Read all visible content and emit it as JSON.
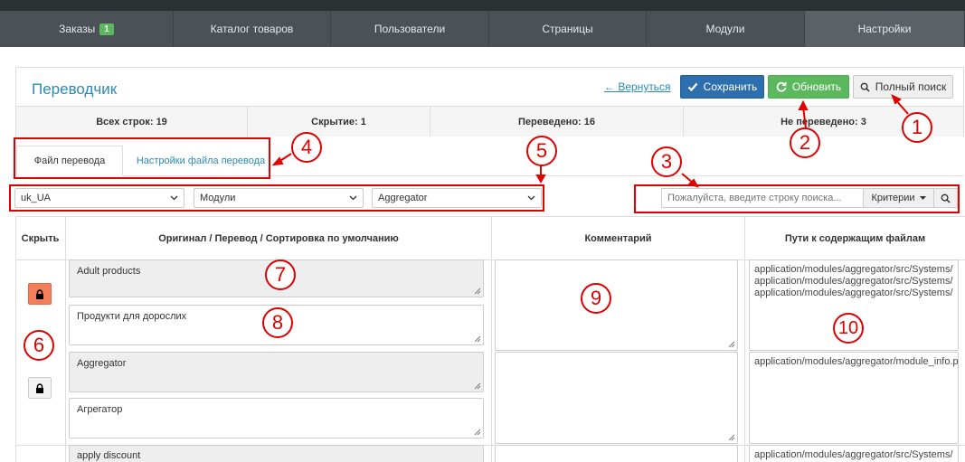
{
  "nav": {
    "items": [
      {
        "label": "Заказы",
        "badge": "1"
      },
      {
        "label": "Каталог товаров"
      },
      {
        "label": "Пользователи"
      },
      {
        "label": "Страницы"
      },
      {
        "label": "Модули"
      },
      {
        "label": "Настройки"
      }
    ]
  },
  "header": {
    "title": "Переводчик",
    "back_label": "← Вернуться",
    "save_label": "Сохранить",
    "refresh_label": "Обновить",
    "fullsearch_label": "Полный поиск"
  },
  "stats": [
    "Всех строк: 19",
    "Скрытие: 1",
    "Переведено: 16",
    "Не переведено: 3"
  ],
  "tabs": [
    "Файл перевода",
    "Настройки файла перевода"
  ],
  "filters": {
    "lang": "uk_UA",
    "type": "Модули",
    "module": "Aggregator",
    "search_placeholder": "Пожалуйста, введите строку поиска...",
    "criteria_label": "Критерии"
  },
  "table": {
    "headers": {
      "hide": "Скрыть",
      "original": "Оригинал / Перевод / Сортировка по умолчанию",
      "comment": "Комментарий",
      "paths": "Пути к содержащим файлам"
    },
    "rows": [
      {
        "original": "Adult products",
        "translation": "Продукти для дорослих",
        "paths": [
          "application/modules/aggregator/src/Systems/",
          "application/modules/aggregator/src/Systems/",
          "application/modules/aggregator/src/Systems/"
        ]
      },
      {
        "original": "Aggregator",
        "translation": "Агрегатор",
        "paths": [
          "application/modules/aggregator/module_info.p"
        ]
      },
      {
        "original": "apply discount",
        "translation": "",
        "paths": [
          "application/modules/aggregator/src/Systems/"
        ]
      }
    ]
  },
  "annotations": [
    "1",
    "2",
    "3",
    "4",
    "5",
    "6",
    "7",
    "8",
    "9",
    "10"
  ],
  "colors": {
    "nav_bg": "#4a5157",
    "primary": "#2d6eaf",
    "success": "#5cb85c",
    "link": "#2a8ab5",
    "lock_active": "#f47e59",
    "annotation": "#e00000"
  }
}
